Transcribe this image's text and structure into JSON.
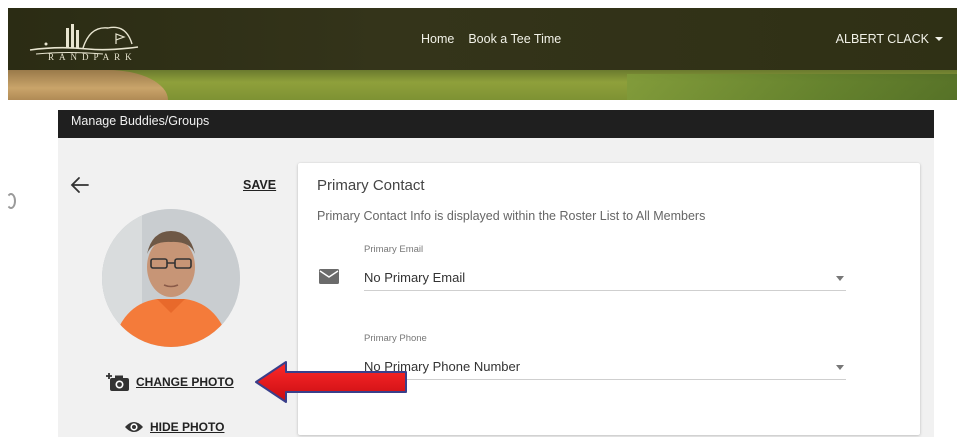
{
  "header": {
    "logo_text": "RANDPARK",
    "nav": [
      "Home",
      "Book a Tee Time"
    ],
    "user_name": "ALBERT CLACK"
  },
  "title_bar": {
    "label": "Manage Buddies/Groups"
  },
  "profile": {
    "save_label": "SAVE",
    "change_photo_label": "CHANGE PHOTO",
    "hide_photo_label": "HIDE PHOTO"
  },
  "primary_contact": {
    "title": "Primary Contact",
    "subtitle": "Primary Contact Info is displayed within the Roster List to All Members",
    "email": {
      "label": "Primary Email",
      "value": "No Primary Email"
    },
    "phone": {
      "label": "Primary Phone",
      "value": "No Primary Phone Number"
    }
  },
  "icons": [
    "back-arrow-icon",
    "envelope-icon",
    "add-camera-icon",
    "eye-icon",
    "chevron-down-icon"
  ],
  "colors": {
    "annotation_arrow": "#e3141c",
    "title_bar": "#1f1f1f"
  }
}
